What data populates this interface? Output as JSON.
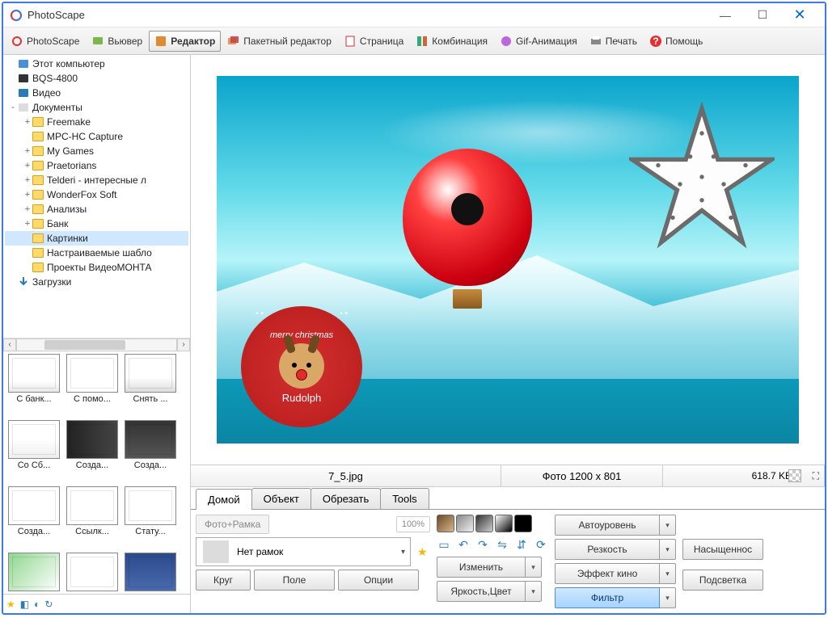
{
  "app": {
    "title": "PhotoScape"
  },
  "toolbar": [
    {
      "id": "photoscape",
      "label": "PhotoScape"
    },
    {
      "id": "viewer",
      "label": "Вьювер"
    },
    {
      "id": "editor",
      "label": "Редактор",
      "active": true
    },
    {
      "id": "batch",
      "label": "Пакетный редактор"
    },
    {
      "id": "page",
      "label": "Страница"
    },
    {
      "id": "combine",
      "label": "Комбинация"
    },
    {
      "id": "gif",
      "label": "Gif-Анимация"
    },
    {
      "id": "print",
      "label": "Печать"
    },
    {
      "id": "help",
      "label": "Помощь"
    }
  ],
  "tree": [
    {
      "label": "Этот компьютер",
      "depth": 0,
      "icon": "pc"
    },
    {
      "label": "BQS-4800",
      "depth": 0,
      "icon": "phone"
    },
    {
      "label": "Видео",
      "depth": 0,
      "icon": "video"
    },
    {
      "label": "Документы",
      "depth": 0,
      "icon": "doc",
      "exp": "-"
    },
    {
      "label": "Freemake",
      "depth": 1,
      "exp": "+",
      "folder": true
    },
    {
      "label": "MPC-HC Capture",
      "depth": 1,
      "folder": true
    },
    {
      "label": "My Games",
      "depth": 1,
      "exp": "+",
      "folder": true
    },
    {
      "label": "Praetorians",
      "depth": 1,
      "exp": "+",
      "folder": true
    },
    {
      "label": "Telderi - интересные л",
      "depth": 1,
      "exp": "+",
      "folder": true
    },
    {
      "label": "WonderFox Soft",
      "depth": 1,
      "exp": "+",
      "folder": true
    },
    {
      "label": "Анализы",
      "depth": 1,
      "exp": "+",
      "folder": true
    },
    {
      "label": "Банк",
      "depth": 1,
      "exp": "+",
      "folder": true
    },
    {
      "label": "Картинки",
      "depth": 1,
      "folder": true,
      "selected": true
    },
    {
      "label": "Настраиваемые шабло",
      "depth": 1,
      "folder": true
    },
    {
      "label": "Проекты ВидеоМОНТА",
      "depth": 1,
      "folder": true
    },
    {
      "label": "Загрузки",
      "depth": 0,
      "icon": "dl"
    }
  ],
  "thumbs": [
    {
      "label": "С банк..."
    },
    {
      "label": "С помо..."
    },
    {
      "label": "Снять ..."
    },
    {
      "label": "Со Сб..."
    },
    {
      "label": "Созда..."
    },
    {
      "label": "Созда..."
    },
    {
      "label": "Созда..."
    },
    {
      "label": "Ссылк..."
    },
    {
      "label": "Стату..."
    },
    {
      "label": ""
    },
    {
      "label": ""
    },
    {
      "label": ""
    }
  ],
  "status": {
    "filename": "7_5.jpg",
    "dimensions": "Фото 1200 x 801",
    "size": "618.7 KB"
  },
  "tabs": [
    {
      "id": "home",
      "label": "Домой",
      "active": true
    },
    {
      "id": "object",
      "label": "Объект"
    },
    {
      "id": "crop",
      "label": "Обрезать"
    },
    {
      "id": "tools",
      "label": "Tools"
    }
  ],
  "controls": {
    "photoFrame": "Фото+Рамка",
    "percent": "100%",
    "noFrames": "Нет рамок",
    "circle": "Круг",
    "field": "Поле",
    "options": "Опции",
    "resize": "Изменить",
    "brightColor": "Яркость,Цвет",
    "autolevel": "Автоуровень",
    "sharpness": "Резкость",
    "filmEffect": "Эффект кино",
    "filter": "Фильтр",
    "saturation": "Насыщеннос",
    "backlight": "Подсветка"
  },
  "badge": {
    "top": "merry christmas",
    "bottom": "Rudolph",
    "dots": "• •"
  }
}
